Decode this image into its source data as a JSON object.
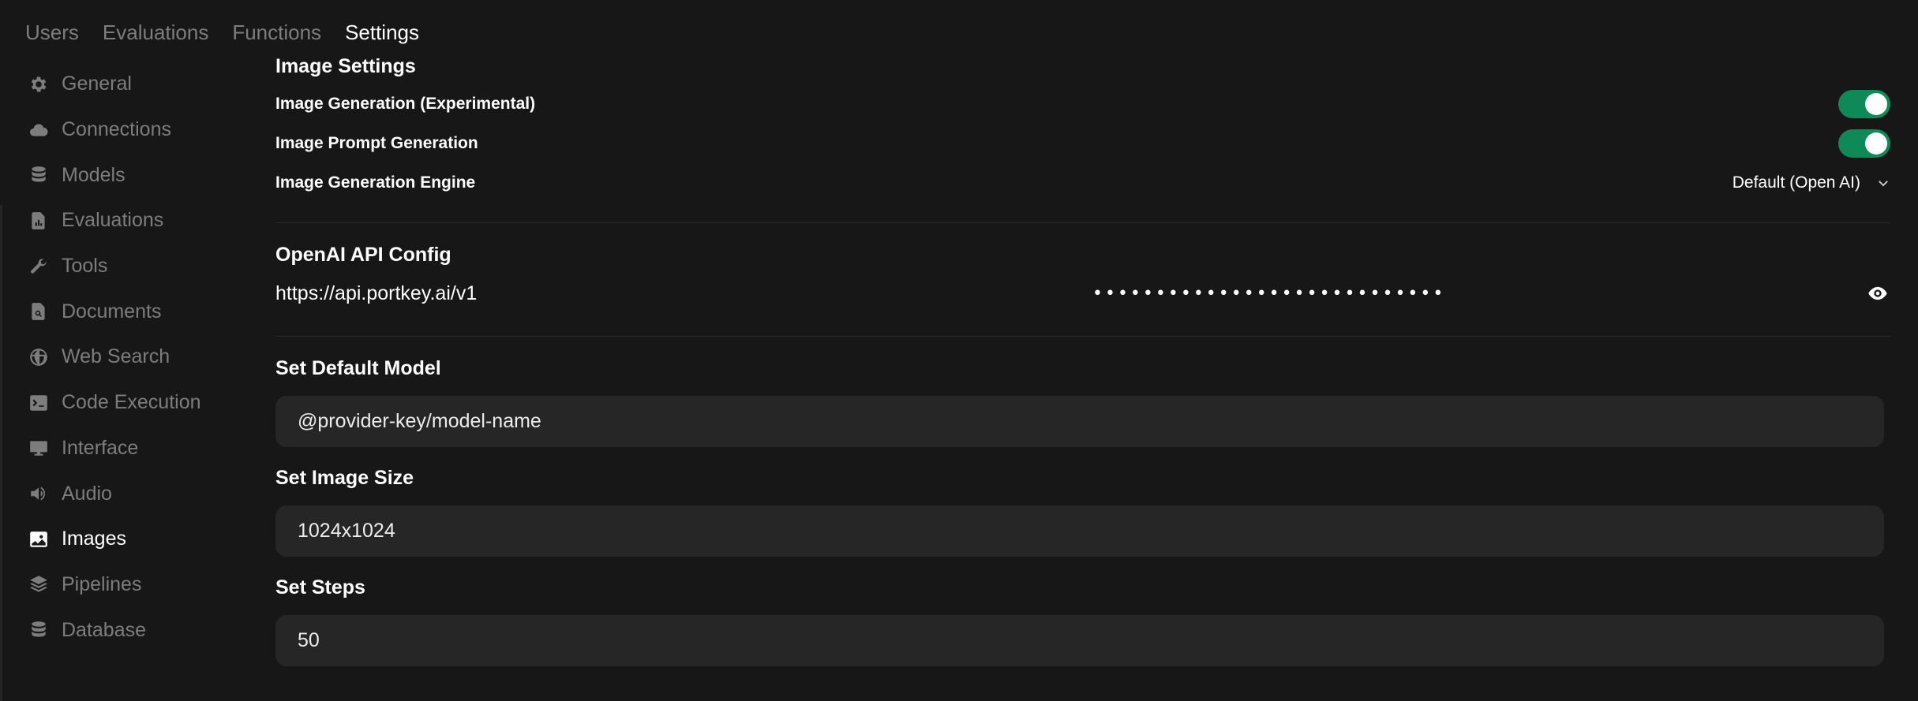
{
  "topnav": {
    "tabs": [
      {
        "label": "Users"
      },
      {
        "label": "Evaluations"
      },
      {
        "label": "Functions"
      },
      {
        "label": "Settings"
      }
    ]
  },
  "sidebar": {
    "items": [
      {
        "label": "General",
        "icon": "gear-icon"
      },
      {
        "label": "Connections",
        "icon": "cloud-icon"
      },
      {
        "label": "Models",
        "icon": "database-icon"
      },
      {
        "label": "Evaluations",
        "icon": "document-chart-icon"
      },
      {
        "label": "Tools",
        "icon": "wrench-icon"
      },
      {
        "label": "Documents",
        "icon": "document-search-icon"
      },
      {
        "label": "Web Search",
        "icon": "globe-icon"
      },
      {
        "label": "Code Execution",
        "icon": "terminal-icon"
      },
      {
        "label": "Interface",
        "icon": "monitor-icon"
      },
      {
        "label": "Audio",
        "icon": "speaker-icon"
      },
      {
        "label": "Images",
        "icon": "image-icon"
      },
      {
        "label": "Pipelines",
        "icon": "stack-icon"
      },
      {
        "label": "Database",
        "icon": "database-icon"
      }
    ]
  },
  "image_settings": {
    "title": "Image Settings",
    "image_generation_label": "Image Generation (Experimental)",
    "image_generation_enabled": true,
    "prompt_generation_label": "Image Prompt Generation",
    "prompt_generation_enabled": true,
    "engine_label": "Image Generation Engine",
    "engine_value": "Default (Open AI)"
  },
  "openai_config": {
    "title": "OpenAI API Config",
    "base_url": "https://api.portkey.ai/v1",
    "api_key_masked": "••••••••••••••••••••••••••••"
  },
  "default_model": {
    "label": "Set Default Model",
    "value": "@provider-key/model-name"
  },
  "image_size": {
    "label": "Set Image Size",
    "value": "1024x1024"
  },
  "steps": {
    "label": "Set Steps",
    "value": "50"
  },
  "colors": {
    "background": "#171717",
    "toggle_on": "#0e8a58",
    "input_bg": "#262626",
    "muted_text": "#7d7d7d"
  }
}
